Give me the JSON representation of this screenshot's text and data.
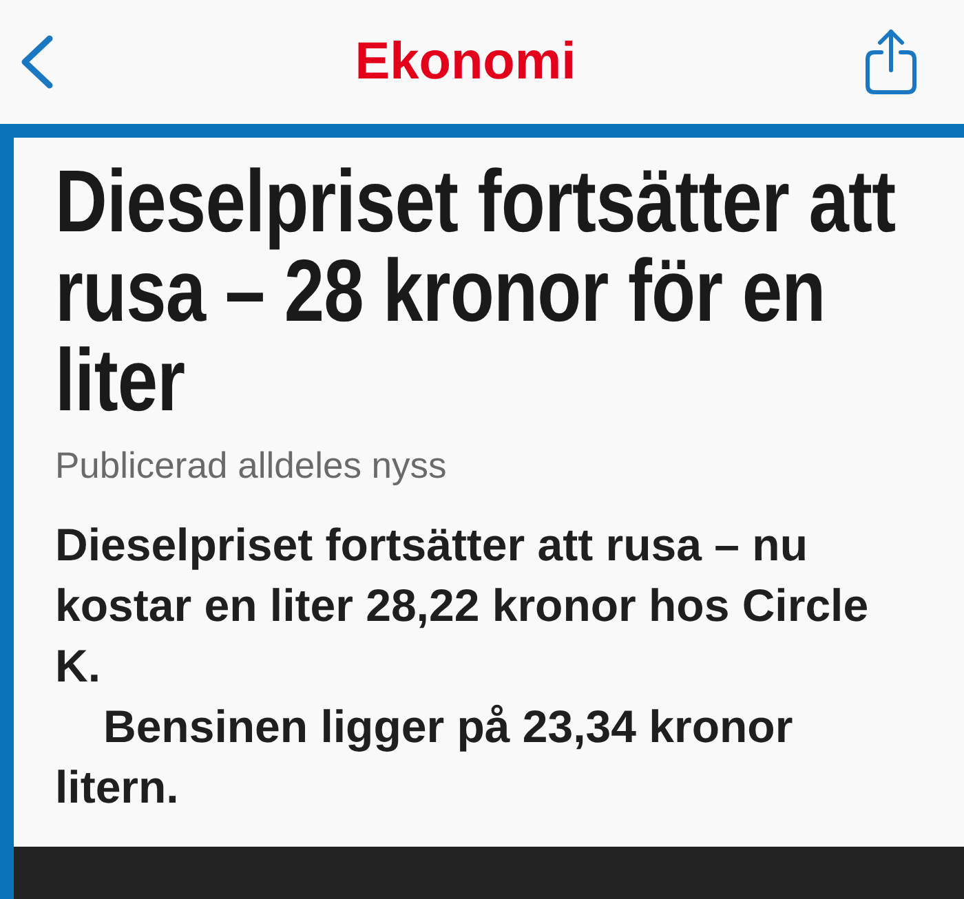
{
  "nav": {
    "title": "Ekonomi"
  },
  "article": {
    "headline": "Dieselpriset fortsätter att rusa – 28 kronor för en liter",
    "meta": "Publicerad alldeles nyss",
    "paragraphs": [
      "Dieselpriset fortsätter att rusa – nu kostar en liter 28,22 kronor hos Circle K.",
      "Bensinen ligger på 23,34 kronor litern."
    ]
  }
}
